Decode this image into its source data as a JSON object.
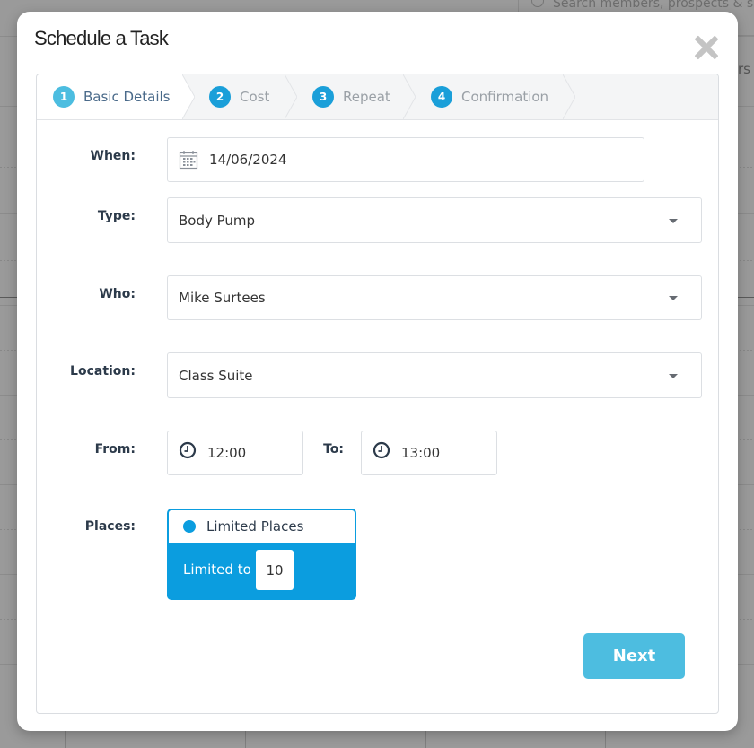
{
  "background": {
    "search_placeholder": "Search members, prospects & s",
    "partial_text": "rs"
  },
  "modal": {
    "title": "Schedule a Task",
    "close_icon": "close-x-icon"
  },
  "wizard": {
    "steps": [
      {
        "number": "1",
        "label": "Basic Details",
        "active": true
      },
      {
        "number": "2",
        "label": "Cost",
        "active": false
      },
      {
        "number": "3",
        "label": "Repeat",
        "active": false
      },
      {
        "number": "4",
        "label": "Confirmation",
        "active": false
      }
    ]
  },
  "form": {
    "when": {
      "label": "When:",
      "value": "14/06/2024",
      "icon": "calendar-icon"
    },
    "type": {
      "label": "Type:",
      "value": "Body Pump"
    },
    "who": {
      "label": "Who:",
      "value": "Mike Surtees"
    },
    "location": {
      "label": "Location:",
      "value": "Class Suite"
    },
    "from": {
      "label": "From:",
      "value": "12:00",
      "icon": "clock-icon"
    },
    "to": {
      "label": "To:",
      "value": "13:00",
      "icon": "clock-icon"
    },
    "places": {
      "label": "Places:",
      "option": "Limited Places",
      "limited_to_label": "Limited to",
      "limited_to_value": "10"
    }
  },
  "actions": {
    "next_label": "Next"
  },
  "colors": {
    "accent": "#0b9ddf",
    "step_badge": "#1a9fd9",
    "active_step_badge": "#4cbde0",
    "next_button": "#4dbde0"
  }
}
